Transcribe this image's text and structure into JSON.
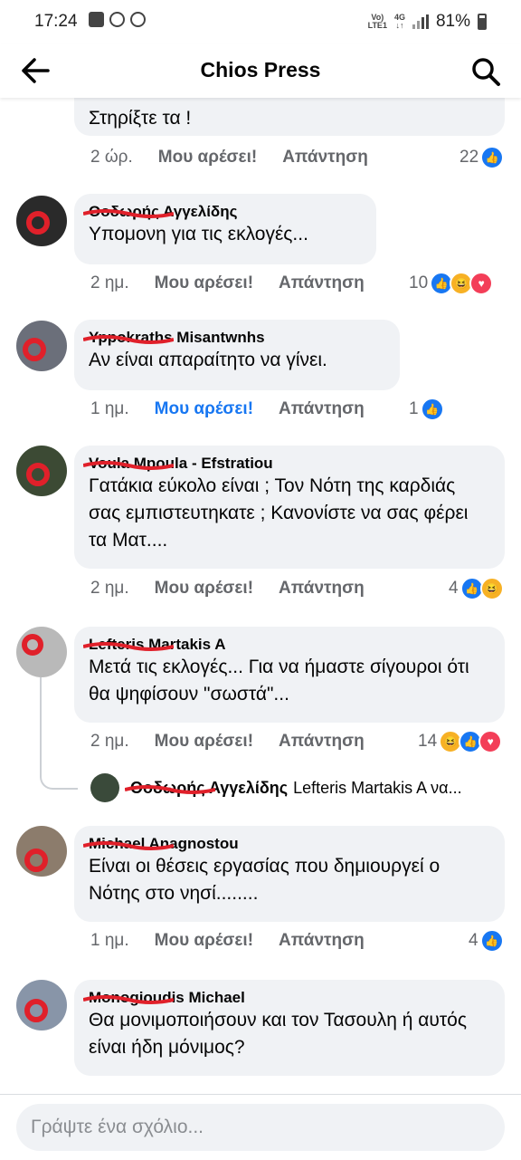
{
  "status_bar": {
    "time": "17:24",
    "network": "Vo) 4G LTE1",
    "battery": "81%"
  },
  "header": {
    "title": "Chios Press"
  },
  "comments": [
    {
      "id": "c0",
      "name": "",
      "text": "Στηρίξτε τα !",
      "time": "2 ώρ.",
      "like": "Μου αρέσει!",
      "reply": "Απάντηση",
      "reactions": "22"
    },
    {
      "id": "c1",
      "name": "Θοδωρής Αγγελίδης",
      "text": "Υπομονη για τις εκλογές...",
      "time": "2 ημ.",
      "like": "Μου αρέσει!",
      "reply": "Απάντηση",
      "reactions": "10"
    },
    {
      "id": "c2",
      "name": "Yppokraths Misantwnhs",
      "text": "Αν είναι απαραίτητο να γίνει.",
      "time": "1 ημ.",
      "like": "Μου αρέσει!",
      "reply": "Απάντηση",
      "reactions": "1",
      "liked": true
    },
    {
      "id": "c3",
      "name": "Voula Mpoula - Efstratiou",
      "text": "Γατάκια εύκολο είναι ; Τον Νότη της καρδιάς σας εμπιστευτηκατε ; Κανονίστε να σας φέρει τα Ματ....",
      "time": "2 ημ.",
      "like": "Μου αρέσει!",
      "reply": "Απάντηση",
      "reactions": "4"
    },
    {
      "id": "c4",
      "name": "Lefteris Martakis A",
      "text": "Μετά τις εκλογές... Για να ήμαστε σίγουροι ότι θα ψηφίσουν \"σωστά\"...",
      "time": "2 ημ.",
      "like": "Μου αρέσει!",
      "reply": "Απάντηση",
      "reactions": "14"
    },
    {
      "id": "c5",
      "name": "Michael Anagnostou",
      "text": "Είναι οι θέσεις εργασίας που δημιουργεί ο Νότης στο νησί........",
      "time": "1 ημ.",
      "like": "Μου αρέσει!",
      "reply": "Απάντηση",
      "reactions": "4"
    },
    {
      "id": "c6",
      "name": "Monogioudis Michael",
      "text": "Θα μονιμοποιήσουν και τον Τασουλη ή αυτός είναι ήδη μόνιμος?",
      "time": "",
      "like": "",
      "reply": "",
      "reactions": ""
    }
  ],
  "reply_preview": {
    "name": "Θοδωρής Αγγελίδης",
    "text": "Lefteris Martakis A να..."
  },
  "composer": {
    "placeholder": "Γράψτε ένα σχόλιο..."
  },
  "colors": {
    "accent": "#1877f2",
    "bubble": "#f0f2f5",
    "scribble": "#e0202a"
  }
}
